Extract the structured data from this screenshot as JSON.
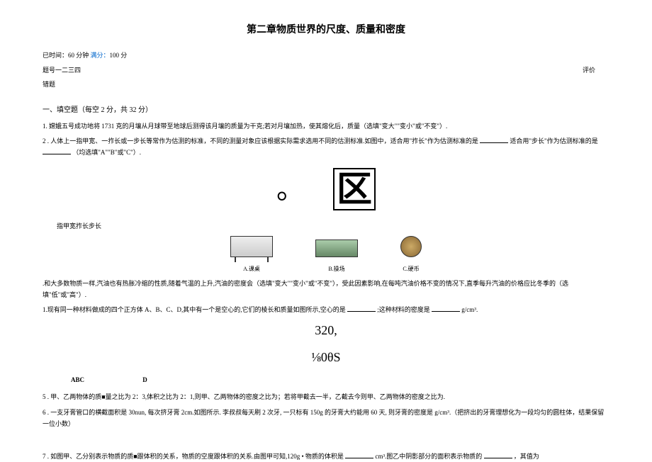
{
  "title": "第二章物质世界的尺度、质量和密度",
  "timer": {
    "prefix": "已时间：",
    "time": "60 分钟",
    "score_label": " 满分：",
    "score": "100 分"
  },
  "score_row": {
    "left": "题号一二三四",
    "right": "评价"
  },
  "wrong_q": "错题",
  "section1": {
    "header": "一、填空题（每空 2 分，共 32 分）",
    "q1": "1. 嫦娥五号成功地将 1731 克的月壤从月球带至地球后测得该月壤的质量为干克;若对月壤加热，使其熔化后，质量（选填\"变大\"\"变小\"或\"不变\"）.",
    "q2_a": "2  . 人体上一指甲宽、一拃长或一步长等常作为估测的标准，不同的测量对象应该根据实际需求选用不同的估测标准.如图中，适合用\"拃长\"作为估测标准的是",
    "q2_b": "适合用\"步长\"作为估测标准的是",
    "q2_c": "（均选填\"A\"\"B\"或\"C\"）.",
    "finger": "指甲宽拃长步长",
    "symbol_circle": "。",
    "symbol_box": "区",
    "items": {
      "a": "A.课桌",
      "b": "B.操场",
      "c": "C.硬币"
    },
    "q3_a": ".和大多数物质一样,汽油也有热胀冷缩的性质,随着气温的上升,汽油的密度会（选填\"变大\"\"变小\"或\"不变\"），受此因素影响,在每吨汽油价格不变的情况下,直季每升汽油的价格应比冬季的（选填\"低\"或\"高\"）.",
    "q4_a": "1.现有同一种材料做成的四个正方体 A、B、C、D,其中有一个是空心的,它们的棱长和质量如图所示,空心的是",
    "q4_b": ";这种材料的密度是",
    "q4_c": "g/cm³.",
    "num1": "320,",
    "num2": "⅛0θS",
    "abc": "ABC",
    "d": "D",
    "q5": "5  . 甲、乙两物体的质■量之比为 2：3,体积之比为 2：1,则甲、乙两物体的密度之比为；若将甲截去一半，乙截去今则甲、乙两物体的密度之比为.",
    "q6": "6  . 一支牙膏管口的横截面积是 30nun, 每次挤牙膏 2cm.如图所示. 李叔叔每天刷 2 次牙, 一只标有 150g 的牙膏大约能用 60 天, 则牙膏的密度是 g/cm³.（把挤出的牙膏理想化为一段均匀的圆柱体，结果保留一位小数）",
    "q7_a": "7  . 如图甲、乙分别表示物质的质■跟体积的关系，物质的空度跟体积的关系.由图甲可知,120g • 物质的体积是",
    "q7_b": "cm³.图乙中阴影部分的面积表示物质的",
    "q7_c": "，其值为"
  }
}
